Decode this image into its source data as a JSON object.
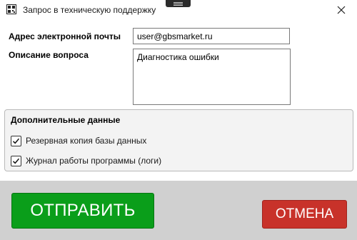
{
  "window": {
    "title": "Запрос в техническую поддержку",
    "app_icon": "qr-icon",
    "close_icon": "close-icon"
  },
  "form": {
    "email_label": "Адрес электронной почты",
    "email_value": "user@gbsmarket.ru",
    "description_label": "Описание вопроса",
    "description_value": "Диагностика ошибки"
  },
  "additional": {
    "title": "Дополнительные данные",
    "options": [
      {
        "label": "Резервная копия базы данных",
        "checked": true
      },
      {
        "label": "Журнал работы программы (логи)",
        "checked": true
      }
    ]
  },
  "buttons": {
    "send_label": "ОТПРАВИТЬ",
    "cancel_label": "ОТМЕНА"
  },
  "colors": {
    "send": "#0a9e1a",
    "cancel": "#c8322a",
    "footer": "#d0d0d0"
  }
}
